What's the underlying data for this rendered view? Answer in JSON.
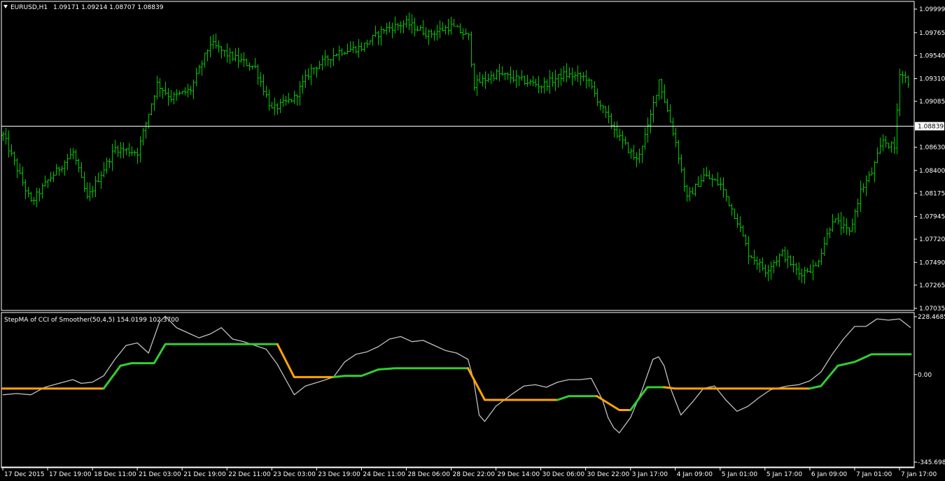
{
  "header": {
    "symbol_label": "EURUSD,H1",
    "ohlc_label": "1.09171 1.09214 1.08707 1.08839"
  },
  "indicator": {
    "label": "StepMA of CCI of Smoother(50,4,5) 154.0199 102.3700"
  },
  "colors": {
    "background": "#000000",
    "bars": "#00c800",
    "frame": "#ffffff",
    "cci_line": "#c0c0c0",
    "step_up": "#32cd32",
    "step_down": "#ffa500",
    "price_marker": "#ffffff"
  },
  "chart_data": [
    {
      "type": "ohlc",
      "title": "EURUSD,H1",
      "current_price": 1.08839,
      "current_price_label": "1.08839",
      "ylim": [
        1.07035,
        1.09999
      ],
      "y_tick_labels": [
        "1.09999",
        "1.09765",
        "1.09540",
        "1.09310",
        "1.09085",
        "1.08630",
        "1.08400",
        "1.08175",
        "1.07945",
        "1.07720",
        "1.07490",
        "1.07265",
        "1.07035"
      ],
      "y_tick_values": [
        1.09999,
        1.09765,
        1.0954,
        1.0931,
        1.09085,
        1.0863,
        1.084,
        1.08175,
        1.07945,
        1.0772,
        1.0749,
        1.07265,
        1.07035
      ],
      "x_tick_labels": [
        "17 Dec 2015",
        "17 Dec 19:00",
        "18 Dec 11:00",
        "21 Dec 03:00",
        "21 Dec 19:00",
        "22 Dec 11:00",
        "23 Dec 03:00",
        "23 Dec 19:00",
        "24 Dec 11:00",
        "28 Dec 06:00",
        "28 Dec 22:00",
        "29 Dec 14:00",
        "30 Dec 06:00",
        "30 Dec 22:00",
        "3 Jan 17:00",
        "4 Jan 09:00",
        "5 Jan 01:00",
        "5 Jan 17:00",
        "6 Jan 09:00",
        "7 Jan 01:00",
        "7 Jan 17:00"
      ],
      "x_tick_bar_index": [
        0,
        16,
        32,
        48,
        64,
        80,
        96,
        112,
        128,
        144,
        160,
        176,
        192,
        208,
        224,
        240,
        256,
        272,
        288,
        304,
        320
      ],
      "bar_count": 324,
      "path_points": [
        [
          0,
          1.0875
        ],
        [
          10,
          1.0808
        ],
        [
          16,
          1.083
        ],
        [
          25,
          1.0858
        ],
        [
          30,
          1.0812
        ],
        [
          40,
          1.0862
        ],
        [
          48,
          1.0858
        ],
        [
          55,
          1.0926
        ],
        [
          60,
          1.0912
        ],
        [
          67,
          1.092
        ],
        [
          74,
          1.0966
        ],
        [
          80,
          1.0955
        ],
        [
          90,
          1.0942
        ],
        [
          96,
          1.09
        ],
        [
          104,
          1.0912
        ],
        [
          110,
          1.094
        ],
        [
          120,
          1.0958
        ],
        [
          128,
          1.0962
        ],
        [
          136,
          1.098
        ],
        [
          144,
          1.0986
        ],
        [
          152,
          1.0975
        ],
        [
          160,
          1.0983
        ],
        [
          166,
          1.0972
        ],
        [
          168,
          1.0925
        ],
        [
          176,
          1.0936
        ],
        [
          184,
          1.093
        ],
        [
          192,
          1.0924
        ],
        [
          200,
          1.0935
        ],
        [
          208,
          1.0932
        ],
        [
          214,
          1.09
        ],
        [
          220,
          1.0872
        ],
        [
          226,
          1.085
        ],
        [
          230,
          1.0882
        ],
        [
          234,
          1.093
        ],
        [
          240,
          1.0868
        ],
        [
          244,
          1.0812
        ],
        [
          250,
          1.0835
        ],
        [
          256,
          1.0826
        ],
        [
          262,
          1.079
        ],
        [
          266,
          1.0758
        ],
        [
          272,
          1.0741
        ],
        [
          278,
          1.0758
        ],
        [
          284,
          1.0738
        ],
        [
          290,
          1.0745
        ],
        [
          296,
          1.0792
        ],
        [
          302,
          1.0778
        ],
        [
          306,
          1.082
        ],
        [
          310,
          1.0838
        ],
        [
          314,
          1.087
        ],
        [
          318,
          1.0862
        ],
        [
          320,
          1.0938
        ],
        [
          324,
          1.0925
        ]
      ]
    },
    {
      "type": "line",
      "title": "StepMA of CCI of Smoother(50,4,5) 154.0199 102.3700",
      "ylim": [
        -345.6986,
        228.4685
      ],
      "y_tick_labels": [
        "228.4685",
        "0.00",
        "-345.6986"
      ],
      "y_tick_values": [
        228.4685,
        0,
        -345.6986
      ],
      "series": [
        {
          "color": "#c0c0c0",
          "points": [
            [
              0,
              -80
            ],
            [
              5,
              -75
            ],
            [
              10,
              -80
            ],
            [
              15,
              -50
            ],
            [
              20,
              -35
            ],
            [
              25,
              -20
            ],
            [
              28,
              -35
            ],
            [
              32,
              -30
            ],
            [
              36,
              -5
            ],
            [
              40,
              60
            ],
            [
              44,
              115
            ],
            [
              48,
              125
            ],
            [
              52,
              85
            ],
            [
              56,
              210
            ],
            [
              58,
              230
            ],
            [
              62,
              185
            ],
            [
              66,
              165
            ],
            [
              70,
              145
            ],
            [
              74,
              160
            ],
            [
              78,
              185
            ],
            [
              82,
              140
            ],
            [
              86,
              130
            ],
            [
              90,
              115
            ],
            [
              94,
              100
            ],
            [
              98,
              40
            ],
            [
              102,
              -40
            ],
            [
              104,
              -80
            ],
            [
              108,
              -45
            ],
            [
              114,
              -25
            ],
            [
              118,
              -10
            ],
            [
              122,
              50
            ],
            [
              126,
              80
            ],
            [
              130,
              90
            ],
            [
              134,
              110
            ],
            [
              138,
              140
            ],
            [
              142,
              150
            ],
            [
              146,
              130
            ],
            [
              150,
              135
            ],
            [
              154,
              115
            ],
            [
              158,
              95
            ],
            [
              162,
              85
            ],
            [
              166,
              60
            ],
            [
              168,
              -20
            ],
            [
              170,
              -160
            ],
            [
              172,
              -185
            ],
            [
              176,
              -125
            ],
            [
              182,
              -75
            ],
            [
              186,
              -45
            ],
            [
              190,
              -40
            ],
            [
              194,
              -50
            ],
            [
              198,
              -30
            ],
            [
              202,
              -20
            ],
            [
              206,
              -20
            ],
            [
              210,
              -15
            ],
            [
              214,
              -100
            ],
            [
              216,
              -170
            ],
            [
              218,
              -210
            ],
            [
              220,
              -230
            ],
            [
              224,
              -170
            ],
            [
              228,
              -65
            ],
            [
              232,
              60
            ],
            [
              234,
              70
            ],
            [
              236,
              35
            ],
            [
              238,
              -45
            ],
            [
              242,
              -160
            ],
            [
              246,
              -110
            ],
            [
              250,
              -55
            ],
            [
              254,
              -45
            ],
            [
              258,
              -100
            ],
            [
              262,
              -145
            ],
            [
              266,
              -125
            ],
            [
              270,
              -90
            ],
            [
              274,
              -60
            ],
            [
              280,
              -45
            ],
            [
              284,
              -40
            ],
            [
              288,
              -25
            ],
            [
              292,
              10
            ],
            [
              296,
              80
            ],
            [
              300,
              140
            ],
            [
              304,
              190
            ],
            [
              308,
              190
            ],
            [
              312,
              220
            ],
            [
              316,
              215
            ],
            [
              320,
              220
            ],
            [
              324,
              185
            ]
          ]
        },
        {
          "color_up": "#32cd32",
          "color_down": "#ffa500",
          "segments": [
            {
              "direction": "down",
              "points": [
                [
                  0,
                  -55
                ],
                [
                  36,
                  -55
                ]
              ]
            },
            {
              "direction": "up",
              "points": [
                [
                  36,
                  -55
                ],
                [
                  42,
                  35
                ],
                [
                  46,
                  45
                ],
                [
                  54,
                  45
                ],
                [
                  58,
                  120
                ],
                [
                  64,
                  120
                ],
                [
                  98,
                  120
                ]
              ]
            },
            {
              "direction": "down",
              "points": [
                [
                  98,
                  120
                ],
                [
                  104,
                  -10
                ],
                [
                  118,
                  -10
                ]
              ]
            },
            {
              "direction": "up",
              "points": [
                [
                  118,
                  -10
                ],
                [
                  122,
                  -5
                ],
                [
                  128,
                  -5
                ],
                [
                  134,
                  20
                ],
                [
                  140,
                  25
                ],
                [
                  166,
                  25
                ]
              ]
            },
            {
              "direction": "down",
              "points": [
                [
                  166,
                  25
                ],
                [
                  172,
                  -100
                ],
                [
                  198,
                  -100
                ]
              ]
            },
            {
              "direction": "up",
              "points": [
                [
                  198,
                  -100
                ],
                [
                  202,
                  -85
                ],
                [
                  212,
                  -85
                ]
              ]
            },
            {
              "direction": "down",
              "points": [
                [
                  212,
                  -85
                ],
                [
                  220,
                  -140
                ],
                [
                  224,
                  -140
                ]
              ]
            },
            {
              "direction": "up",
              "points": [
                [
                  224,
                  -140
                ],
                [
                  230,
                  -50
                ],
                [
                  236,
                  -50
                ]
              ]
            },
            {
              "direction": "down",
              "points": [
                [
                  236,
                  -50
                ],
                [
                  240,
                  -55
                ],
                [
                  288,
                  -55
                ]
              ]
            },
            {
              "direction": "up",
              "points": [
                [
                  288,
                  -55
                ],
                [
                  292,
                  -45
                ],
                [
                  298,
                  35
                ],
                [
                  304,
                  50
                ],
                [
                  310,
                  80
                ],
                [
                  316,
                  80
                ],
                [
                  324,
                  80
                ]
              ]
            }
          ]
        }
      ]
    }
  ]
}
